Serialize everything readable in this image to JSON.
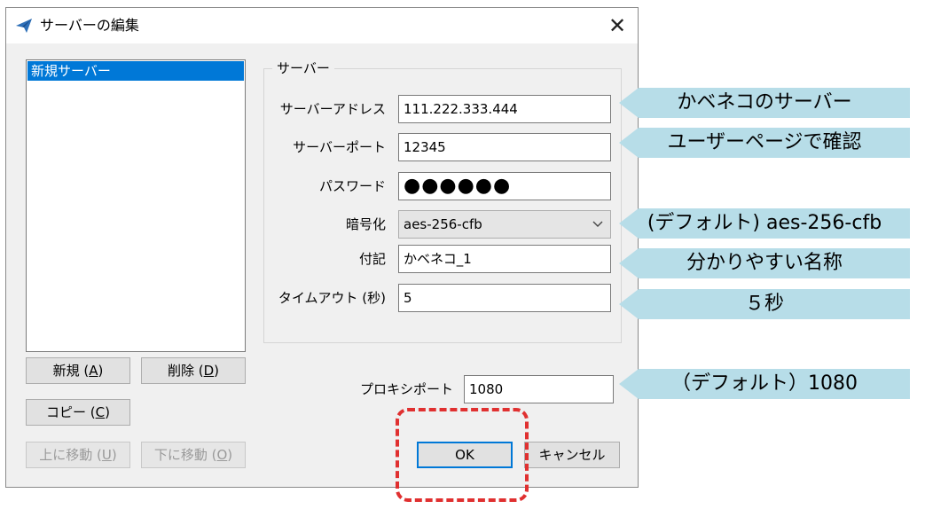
{
  "dialog": {
    "title": "サーバーの編集",
    "close_glyph": "✕"
  },
  "server_list": {
    "items": [
      "新規サーバー"
    ]
  },
  "buttons": {
    "new": {
      "label": "新規 (",
      "key": "A",
      "suffix": ")"
    },
    "delete": {
      "label": "削除 (",
      "key": "D",
      "suffix": ")"
    },
    "copy": {
      "label": "コピー (",
      "key": "C",
      "suffix": ")"
    },
    "move_up": {
      "label": "上に移動 (",
      "key": "U",
      "suffix": ")"
    },
    "move_down": {
      "label": "下に移動 (",
      "key": "O",
      "suffix": ")"
    },
    "ok": "OK",
    "cancel": "キャンセル"
  },
  "server_group": {
    "legend": "サーバー",
    "address_label": "サーバーアドレス",
    "address_value": "111.222.333.444",
    "port_label": "サーバーポート",
    "port_value": "12345",
    "password_label": "パスワード",
    "password_value": "●●●●●●",
    "encryption_label": "暗号化",
    "encryption_value": "aes-256-cfb",
    "remarks_label": "付記",
    "remarks_value": "かベネコ_1",
    "timeout_label": "タイムアウト (秒)",
    "timeout_value": "5"
  },
  "proxy": {
    "port_label": "プロキシポート",
    "port_value": "1080"
  },
  "callouts": {
    "address": "かベネコのサーバー",
    "port": "ユーザーページで確認",
    "encryption": "(デフォルト) aes-256-cfb",
    "remarks": "分かりやすい名称",
    "timeout": "５秒",
    "proxy": "（デフォルト）1080"
  },
  "colors": {
    "selection": "#0078d7",
    "callout": "#b7dde8",
    "highlight": "#e03030"
  }
}
